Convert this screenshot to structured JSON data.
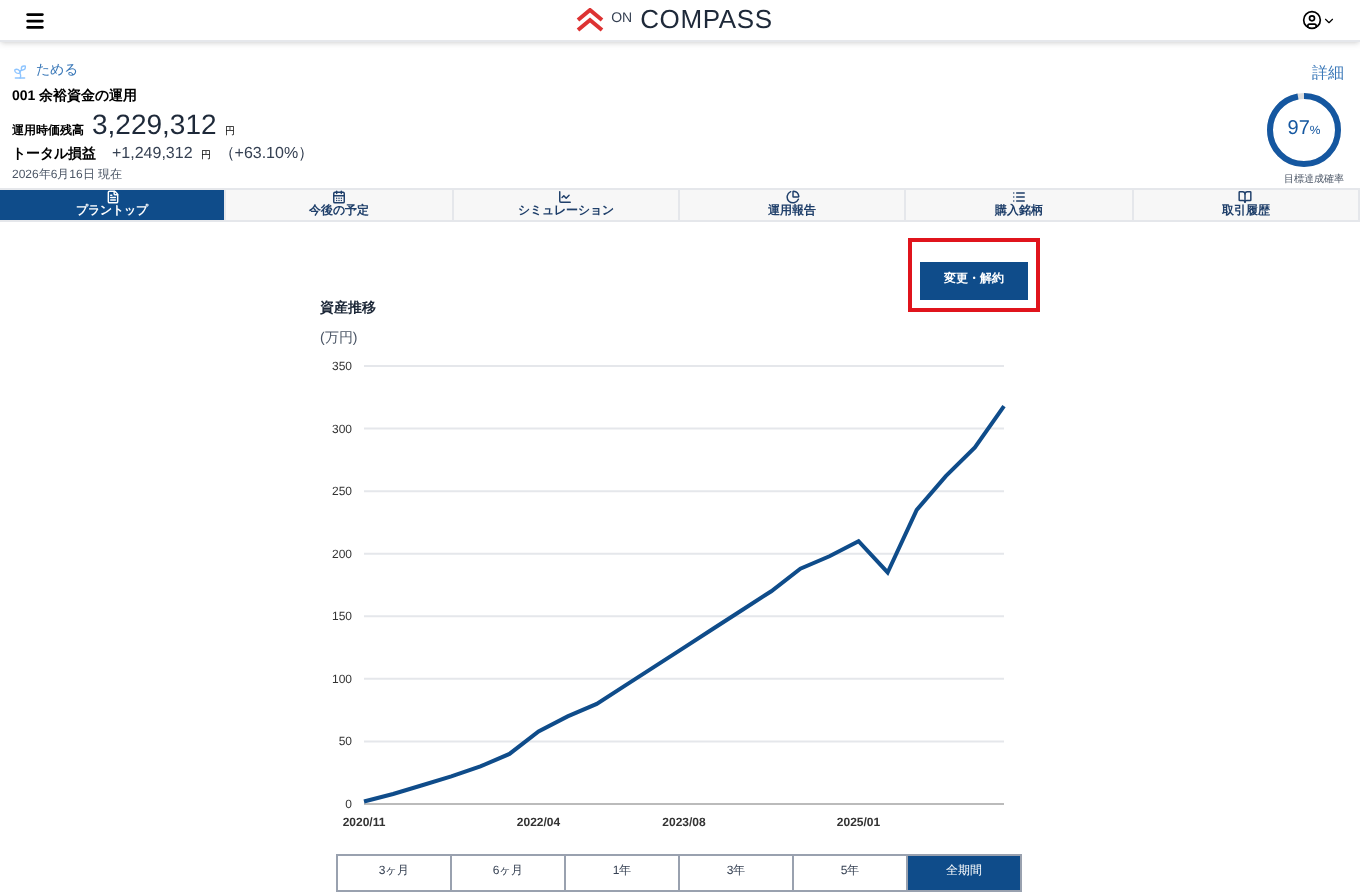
{
  "header": {
    "logo_prefix": "ON",
    "logo_text": "COMPASS"
  },
  "summary": {
    "category": "ためる",
    "plan_name": "001 余裕資金の運用",
    "value_label": "運用時価残高",
    "value": "3,229,312",
    "value_unit": "円",
    "profit_label": "トータル損益",
    "profit": "+1,249,312",
    "profit_unit": "円",
    "profit_rate": "（+63.10%）",
    "as_of": "2026年6月16日 現在",
    "detail_link": "詳細",
    "achievement": "97",
    "achievement_unit": "%",
    "achievement_label": "目標達成確率"
  },
  "tabs": [
    {
      "label": "プラントップ",
      "selected": true,
      "kind": "doc"
    },
    {
      "label": "今後の予定",
      "selected": false,
      "kind": "calendar"
    },
    {
      "label": "シミュレーション",
      "selected": false,
      "kind": "chart"
    },
    {
      "label": "運用報告",
      "selected": false,
      "kind": "pie"
    },
    {
      "label": "購入銘柄",
      "selected": false,
      "kind": "list"
    },
    {
      "label": "取引履歴",
      "selected": false,
      "kind": "book"
    }
  ],
  "change_button": "変更・解約",
  "chart": {
    "chart_data": {
      "type": "line",
      "title": "資産推移",
      "ylabel": "(万円)",
      "categories": [
        "2020/11",
        null,
        null,
        null,
        null,
        null,
        "2022/04",
        null,
        null,
        null,
        null,
        "2023/08",
        null,
        null,
        null,
        null,
        null,
        "2025/01",
        null,
        null,
        null,
        null,
        null
      ],
      "series": [
        {
          "color": "#0f4c8a",
          "values": [
            2,
            8,
            15,
            22,
            30,
            40,
            58,
            70,
            80,
            95,
            110,
            125,
            140,
            155,
            170,
            188,
            198,
            210,
            185,
            235,
            262,
            285,
            318
          ]
        }
      ],
      "ylim": [
        0,
        350
      ],
      "grid": true,
      "yticks": [
        0,
        50,
        100,
        150,
        200,
        250,
        300,
        350
      ]
    }
  },
  "ranges": [
    {
      "label": "3ヶ月",
      "selected": false
    },
    {
      "label": "6ヶ月",
      "selected": false
    },
    {
      "label": "1年",
      "selected": false
    },
    {
      "label": "3年",
      "selected": false
    },
    {
      "label": "5年",
      "selected": false
    },
    {
      "label": "全期間",
      "selected": true
    }
  ]
}
